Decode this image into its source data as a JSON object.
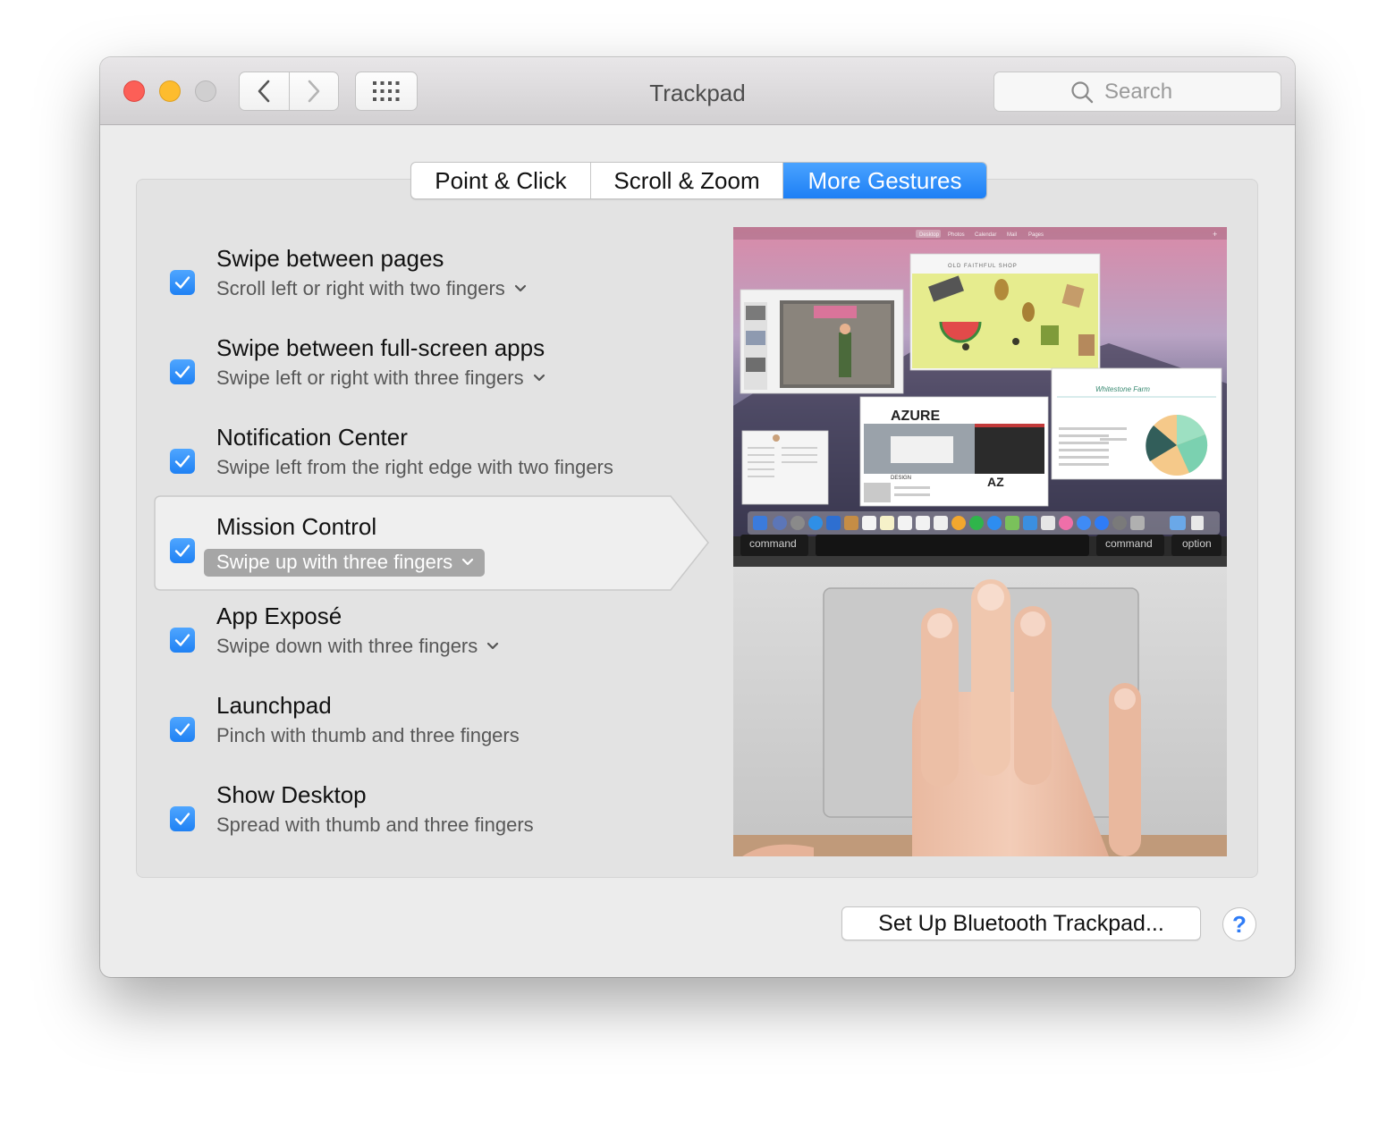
{
  "window": {
    "title": "Trackpad"
  },
  "search": {
    "placeholder": "Search"
  },
  "tabs": [
    {
      "label": "Point & Click"
    },
    {
      "label": "Scroll & Zoom"
    },
    {
      "label": "More Gestures"
    }
  ],
  "gestures": [
    {
      "title": "Swipe between pages",
      "subtitle": "Scroll left or right with two fingers",
      "has_menu": true,
      "checked": true
    },
    {
      "title": "Swipe between full-screen apps",
      "subtitle": "Swipe left or right with three fingers",
      "has_menu": true,
      "checked": true
    },
    {
      "title": "Notification Center",
      "subtitle": "Swipe left from the right edge with two fingers",
      "has_menu": false,
      "checked": true
    },
    {
      "title": "Mission Control",
      "subtitle": "Swipe up with three fingers",
      "has_menu": true,
      "checked": true
    },
    {
      "title": "App Exposé",
      "subtitle": "Swipe down with three fingers",
      "has_menu": true,
      "checked": true
    },
    {
      "title": "Launchpad",
      "subtitle": "Pinch with thumb and three fingers",
      "has_menu": false,
      "checked": true
    },
    {
      "title": "Show Desktop",
      "subtitle": "Spread with thumb and three fingers",
      "has_menu": false,
      "checked": true
    }
  ],
  "preview": {
    "menubar": [
      "Desktop",
      "Photos",
      "Calendar",
      "Mail",
      "Pages"
    ],
    "window_titles": [
      "OLD FAITHFUL SHOP",
      "Whitestone Farm",
      "AZURE",
      "DESIGN",
      "AZ"
    ],
    "keys": [
      "command",
      "command",
      "option"
    ]
  },
  "footer": {
    "bluetooth_button": "Set Up Bluetooth Trackpad...",
    "help_button": "?"
  },
  "colors": {
    "accent": "#1d7ff5",
    "close": "#fc5f57",
    "minimize": "#fdbc2e",
    "zoom_disabled": "#d0cfd0",
    "selected_row_pill": "#a6a6a6"
  }
}
